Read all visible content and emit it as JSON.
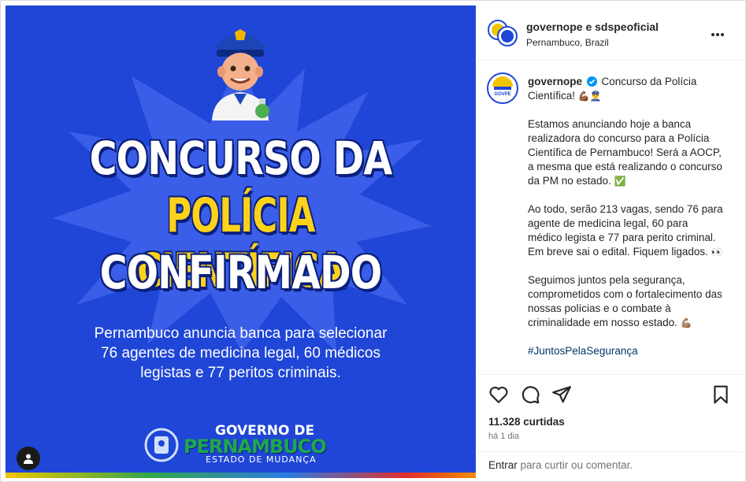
{
  "media": {
    "headline_line1": "CONCURSO DA",
    "headline_line2": "POLÍCIA CIENTÍFICA",
    "headline_line3": "CONFIRMADO",
    "sub_line1": "Pernambuco anuncia banca para selecionar",
    "sub_line2": "76 agentes de medicina legal, 60 médicos",
    "sub_line3": "legistas e 77 peritos criminais.",
    "logo_top": "GOVERNO DE",
    "logo_mid": "PERNAMBUCO",
    "logo_bottom": "ESTADO DE MUDANÇA",
    "colors": {
      "background": "#1f46d6",
      "headline_white": "#ffffff",
      "headline_yellow": "#ffd21a"
    }
  },
  "header": {
    "names": "governope e sdspeoficial",
    "location": "Pernambuco, Brazil",
    "more_icon": "more-horizontal-icon"
  },
  "caption": {
    "username": "governope",
    "intro": "Concurso da Polícia Científica!",
    "intro_emoji": "💪🏾👮‍♂️",
    "para1": "Estamos anunciando hoje a banca realizadora do concurso para a Polícia Científica de Pernambuco! Será a AOCP, a mesma que está realizando o concurso da PM no estado.",
    "para1_emoji": "✅",
    "para2": "Ao todo, serão 213 vagas, sendo 76 para agente de medicina legal, 60 para médico legista e 77 para perito criminal. Em breve sai o edital. Fiquem ligados.",
    "para2_emoji": "👀",
    "para3": "Seguimos juntos pela segurança, comprometidos com o fortalecimento das nossas polícias e o combate à criminalidade em nosso estado.",
    "para3_emoji": "💪🏽",
    "hashtag": "#JuntosPelaSegurança",
    "avatar_label": "GOVPE"
  },
  "actions": {
    "like_icon": "heart-icon",
    "comment_icon": "comment-icon",
    "share_icon": "send-icon",
    "save_icon": "bookmark-icon"
  },
  "stats": {
    "likes": "11.328 curtidas",
    "time": "há 1 dia"
  },
  "comment": {
    "login_link": "Entrar",
    "placeholder": " para curtir ou comentar."
  }
}
